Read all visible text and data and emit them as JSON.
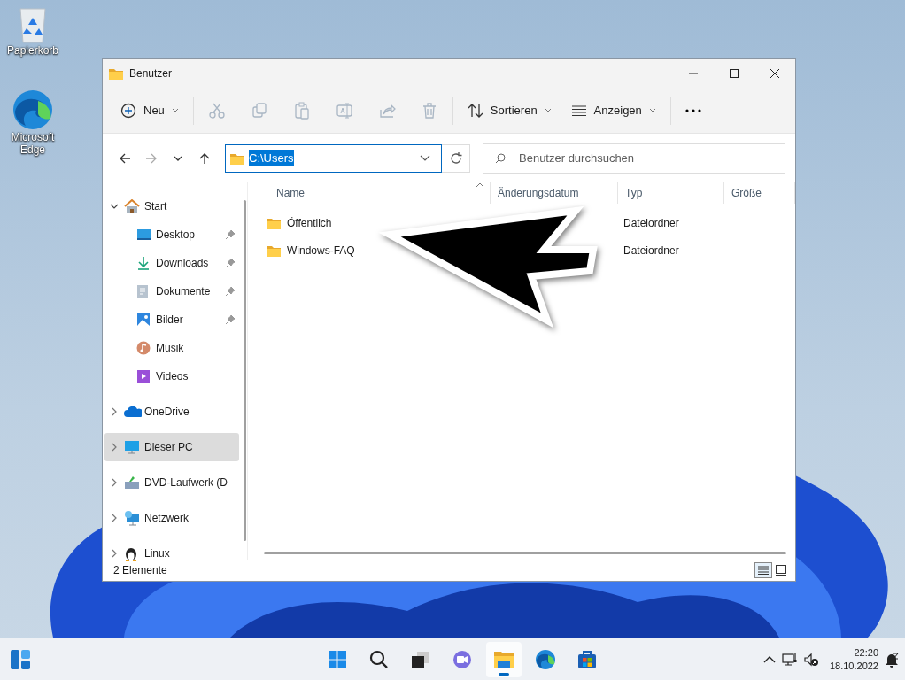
{
  "desktop_icons": [
    {
      "kind": "recycle-bin",
      "label": "Papierkorb"
    },
    {
      "kind": "edge",
      "label": "Microsoft Edge"
    }
  ],
  "window": {
    "title": "Benutzer"
  },
  "toolbar": {
    "new_label": "Neu",
    "actions": [
      {
        "kind": "cut",
        "disabled": true
      },
      {
        "kind": "copy",
        "disabled": true
      },
      {
        "kind": "paste",
        "disabled": true
      },
      {
        "kind": "rename",
        "disabled": true
      },
      {
        "kind": "share",
        "disabled": true
      },
      {
        "kind": "delete",
        "disabled": true
      }
    ],
    "sort_label": "Sortieren",
    "view_label": "Anzeigen"
  },
  "navigation": {
    "forward_disabled": true
  },
  "address": {
    "value": "C:\\Users",
    "selected": true
  },
  "search": {
    "placeholder": "Benutzer durchsuchen"
  },
  "sidebar": {
    "items": [
      {
        "kind": "home",
        "label": "Start",
        "expanded": true,
        "selected": false,
        "children": [
          {
            "kind": "desktop",
            "label": "Desktop",
            "pinned": true
          },
          {
            "kind": "downloads",
            "label": "Downloads",
            "pinned": true
          },
          {
            "kind": "documents",
            "label": "Dokumente",
            "pinned": true
          },
          {
            "kind": "pictures",
            "label": "Bilder",
            "pinned": true
          },
          {
            "kind": "music",
            "label": "Musik",
            "pinned": false
          },
          {
            "kind": "videos",
            "label": "Videos",
            "pinned": false
          }
        ]
      },
      {
        "kind": "onedrive",
        "label": "OneDrive",
        "expanded": false,
        "selected": false
      },
      {
        "kind": "pc",
        "label": "Dieser PC",
        "expanded": false,
        "selected": true
      },
      {
        "kind": "dvd",
        "label": "DVD-Laufwerk (D",
        "expanded": false,
        "selected": false
      },
      {
        "kind": "network",
        "label": "Netzwerk",
        "expanded": false,
        "selected": false
      },
      {
        "kind": "linux",
        "label": "Linux",
        "expanded": false,
        "selected": false
      }
    ]
  },
  "table": {
    "columns": [
      "Name",
      "Änderungsdatum",
      "Typ",
      "Größe"
    ],
    "rows": [
      {
        "name": "Öffentlich",
        "type": "Dateiordner"
      },
      {
        "name": "Windows-FAQ",
        "type": "Dateiordner"
      }
    ]
  },
  "status_bar": {
    "count": "2 Elemente",
    "view_modes": [
      {
        "kind": "details",
        "selected": true
      },
      {
        "kind": "tiles",
        "selected": false
      }
    ]
  },
  "taskbar": {
    "apps": [
      {
        "kind": "start",
        "active": false
      },
      {
        "kind": "search",
        "active": false
      },
      {
        "kind": "taskview",
        "active": false
      },
      {
        "kind": "chat",
        "active": false
      },
      {
        "kind": "explorer",
        "active": true
      },
      {
        "kind": "edge",
        "active": false
      },
      {
        "kind": "store",
        "active": false
      }
    ],
    "time": "22:20",
    "date": "18.10.2022"
  }
}
